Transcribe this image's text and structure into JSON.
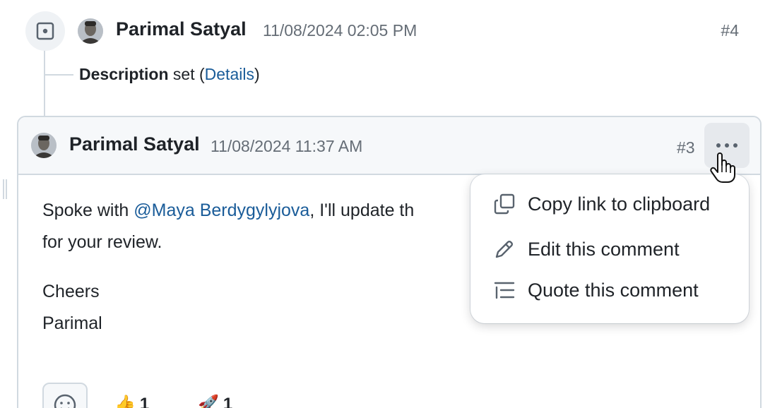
{
  "event": {
    "author": "Parimal Satyal",
    "timestamp": "11/08/2024 02:05 PM",
    "number": "#4",
    "description_label": "Description",
    "description_action": "set (",
    "details_link": "Details",
    "description_close": ")"
  },
  "comment": {
    "author": "Parimal Satyal",
    "timestamp": "11/08/2024 11:37 AM",
    "number": "#3",
    "body_prefix": "Spoke with ",
    "mention": "@Maya Berdygylyjova",
    "body_suffix": ", I'll update th",
    "body_line2": "for your review.",
    "signoff_1": "Cheers",
    "signoff_2": "Parimal",
    "reactions": [
      {
        "emoji": "👍",
        "count": "1"
      },
      {
        "emoji": "🚀",
        "count": "1"
      }
    ]
  },
  "menu": {
    "items": [
      {
        "label": "Copy link to clipboard",
        "icon": "copy-icon"
      },
      {
        "label": "Edit this comment",
        "icon": "pencil-icon"
      },
      {
        "label": "Quote this comment",
        "icon": "quote-icon"
      }
    ]
  },
  "colors": {
    "link": "#1a5c99",
    "muted": "#656d76",
    "border": "#d1d9e0",
    "header_bg": "#f6f8fa"
  }
}
